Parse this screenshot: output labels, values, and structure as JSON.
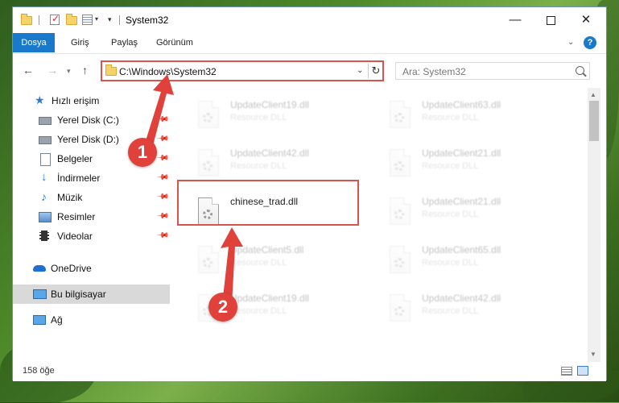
{
  "window": {
    "title": "System32",
    "ribbon_tabs": [
      "Dosya",
      "Giriş",
      "Paylaş",
      "Görünüm"
    ],
    "help_label": "?"
  },
  "navigation": {
    "address": "C:\\Windows\\System32",
    "search_placeholder": "Ara: System32"
  },
  "sidebar": {
    "items": [
      {
        "label": "Hızlı erişim",
        "icon": "star-icon",
        "pinned": false
      },
      {
        "label": "Yerel Disk (C:)",
        "icon": "drive-icon",
        "pinned": true
      },
      {
        "label": "Yerel Disk (D:)",
        "icon": "drive-icon",
        "pinned": true
      },
      {
        "label": "Belgeler",
        "icon": "documents-icon",
        "pinned": true
      },
      {
        "label": "İndirmeler",
        "icon": "download-icon",
        "pinned": true
      },
      {
        "label": "Müzik",
        "icon": "music-icon",
        "pinned": true
      },
      {
        "label": "Resimler",
        "icon": "pictures-icon",
        "pinned": true
      },
      {
        "label": "Videolar",
        "icon": "videos-icon",
        "pinned": true
      },
      {
        "label": "OneDrive",
        "icon": "cloud-icon",
        "pinned": false
      },
      {
        "label": "Bu bilgisayar",
        "icon": "computer-icon",
        "pinned": false,
        "selected": true
      },
      {
        "label": "Ağ",
        "icon": "network-icon",
        "pinned": false
      }
    ]
  },
  "files": [
    {
      "name": "UpdateClient19.dll",
      "type": "Resource DLL",
      "faded": true
    },
    {
      "name": "UpdateClient63.dll",
      "type": "Resource DLL",
      "faded": true
    },
    {
      "name": "UpdateClient42.dll",
      "type": "Resource DLL",
      "faded": true
    },
    {
      "name": "UpdateClient21.dll",
      "type": "Resource DLL",
      "faded": true
    },
    {
      "name": "chinese_trad.dll",
      "type": "",
      "faded": false
    },
    {
      "name": "UpdateClient21.dll",
      "type": "Resource DLL",
      "faded": true
    },
    {
      "name": "UpdateClient5.dll",
      "type": "Resource DLL",
      "faded": true
    },
    {
      "name": "UpdateClient65.dll",
      "type": "Resource DLL",
      "faded": true
    },
    {
      "name": "UpdateClient19.dll",
      "type": "Resource DLL",
      "faded": true
    },
    {
      "name": "UpdateClient42.dll",
      "type": "Resource DLL",
      "faded": true
    }
  ],
  "status": {
    "item_count": "158 öğe"
  },
  "callouts": [
    "1",
    "2"
  ],
  "colors": {
    "accent": "#1979ca",
    "highlight": "#d9534f",
    "callout": "#e0413a"
  }
}
